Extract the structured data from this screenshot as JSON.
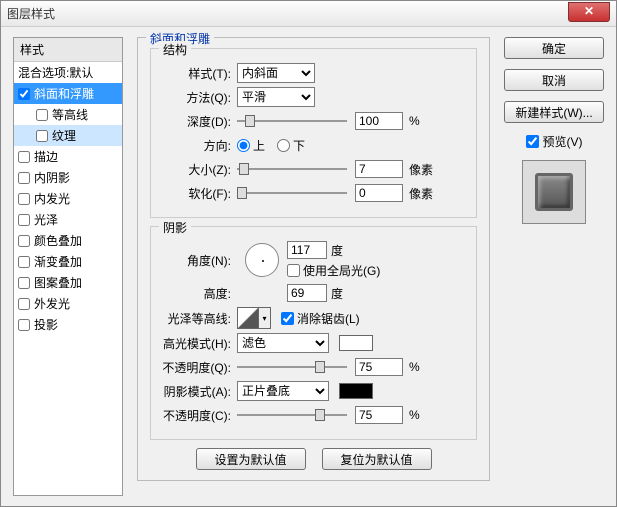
{
  "window": {
    "title": "图层样式"
  },
  "sidebar": {
    "header": "样式",
    "items": [
      {
        "label": "混合选项:默认",
        "checkbox": false
      },
      {
        "label": "斜面和浮雕",
        "checkbox": true,
        "checked": true,
        "selected": true
      },
      {
        "label": "等高线",
        "checkbox": true,
        "checked": false,
        "sub": true
      },
      {
        "label": "纹理",
        "checkbox": true,
        "checked": false,
        "sub": true,
        "hl": true
      },
      {
        "label": "描边",
        "checkbox": true,
        "checked": false
      },
      {
        "label": "内阴影",
        "checkbox": true,
        "checked": false
      },
      {
        "label": "内发光",
        "checkbox": true,
        "checked": false
      },
      {
        "label": "光泽",
        "checkbox": true,
        "checked": false
      },
      {
        "label": "颜色叠加",
        "checkbox": true,
        "checked": false
      },
      {
        "label": "渐变叠加",
        "checkbox": true,
        "checked": false
      },
      {
        "label": "图案叠加",
        "checkbox": true,
        "checked": false
      },
      {
        "label": "外发光",
        "checkbox": true,
        "checked": false
      },
      {
        "label": "投影",
        "checkbox": true,
        "checked": false
      }
    ]
  },
  "panel": {
    "title": "斜面和浮雕",
    "structure": {
      "title": "结构",
      "style_label": "样式(T):",
      "style_value": "内斜面",
      "technique_label": "方法(Q):",
      "technique_value": "平滑",
      "depth_label": "深度(D):",
      "depth_value": "100",
      "depth_unit": "%",
      "direction_label": "方向:",
      "direction_up": "上",
      "direction_down": "下",
      "size_label": "大小(Z):",
      "size_value": "7",
      "size_unit": "像素",
      "soften_label": "软化(F):",
      "soften_value": "0",
      "soften_unit": "像素"
    },
    "shading": {
      "title": "阴影",
      "angle_label": "角度(N):",
      "angle_value": "117",
      "angle_unit": "度",
      "global_light_label": "使用全局光(G)",
      "altitude_label": "高度:",
      "altitude_value": "69",
      "altitude_unit": "度",
      "gloss_label": "光泽等高线:",
      "antialias_label": "消除锯齿(L)",
      "highlight_mode_label": "高光模式(H):",
      "highlight_mode_value": "滤色",
      "highlight_opacity_label": "不透明度(Q):",
      "highlight_opacity_value": "75",
      "opacity_unit": "%",
      "shadow_mode_label": "阴影模式(A):",
      "shadow_mode_value": "正片叠底",
      "shadow_opacity_label": "不透明度(C):",
      "shadow_opacity_value": "75"
    },
    "buttons": {
      "make_default": "设置为默认值",
      "reset_default": "复位为默认值"
    }
  },
  "right": {
    "ok": "确定",
    "cancel": "取消",
    "new_style": "新建样式(W)...",
    "preview_label": "预览(V)"
  }
}
